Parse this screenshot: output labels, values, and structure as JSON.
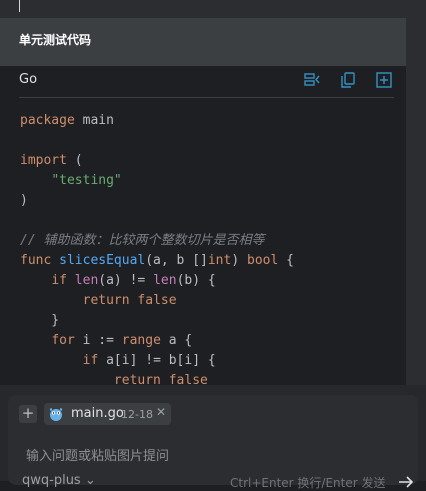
{
  "header": {
    "title": "单元测试代码"
  },
  "code_block": {
    "language": "Go",
    "toolbar": {
      "icons": [
        "insert-at-cursor-icon",
        "copy-icon",
        "new-file-icon"
      ]
    },
    "lines": [
      "package main",
      "",
      "import (",
      "    \"testing\"",
      ")",
      "",
      "// 辅助函数：比较两个整数切片是否相等",
      "func slicesEqual(a, b []int) bool {",
      "    if len(a) != len(b) {",
      "        return false",
      "    }",
      "    for i := range a {",
      "        if a[i] != b[i] {",
      "            return false"
    ]
  },
  "input": {
    "add_label": "+",
    "file_chip": {
      "name": "main.go",
      "range": "12-18",
      "close": "✕"
    },
    "placeholder": "输入问题或粘贴图片提问",
    "model": "qwq-plus ⌄",
    "hint": "Ctrl+Enter 换行/Enter 发送"
  },
  "colors": {
    "accent": "#56a8f5",
    "background": "#1e1f22",
    "header": "#3c3f41"
  }
}
